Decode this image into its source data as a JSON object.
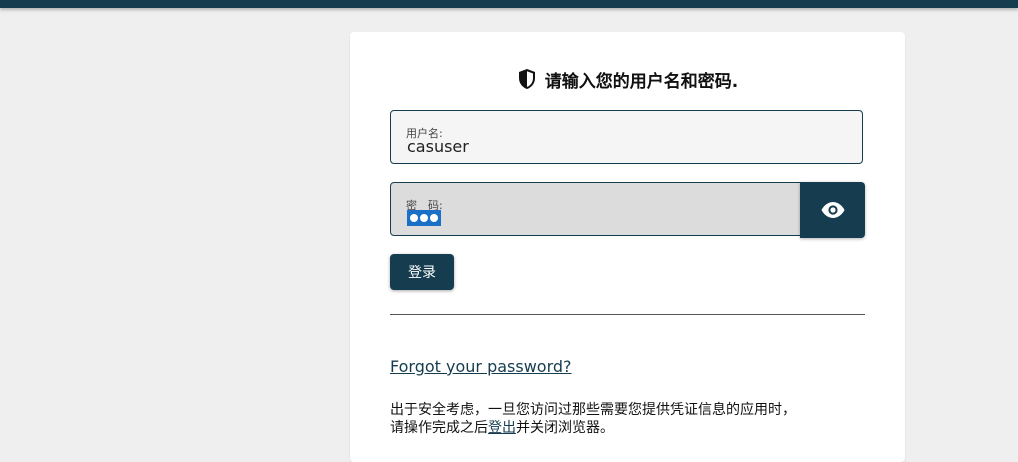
{
  "login": {
    "heading": "请输入您的用户名和密码.",
    "username_label": "用户名:",
    "username_value": "casuser",
    "password_label": "密　码:",
    "submit_label": "登录",
    "forgot_link": "Forgot your password?",
    "notice_line1": "出于安全考虑，一旦您访问过那些需要您提供凭证信息的应用时，",
    "notice_line2_prefix": "请操作完成之后",
    "notice_logout_link": "登出",
    "notice_line2_suffix": "并关闭浏览器。"
  },
  "icons": {
    "heading_icon": "shield-icon",
    "toggle_icon": "eye-icon"
  },
  "colors": {
    "primary": "#153d4f",
    "background": "#efefef",
    "card": "#ffffff",
    "password_selection": "#1a6fc7"
  }
}
